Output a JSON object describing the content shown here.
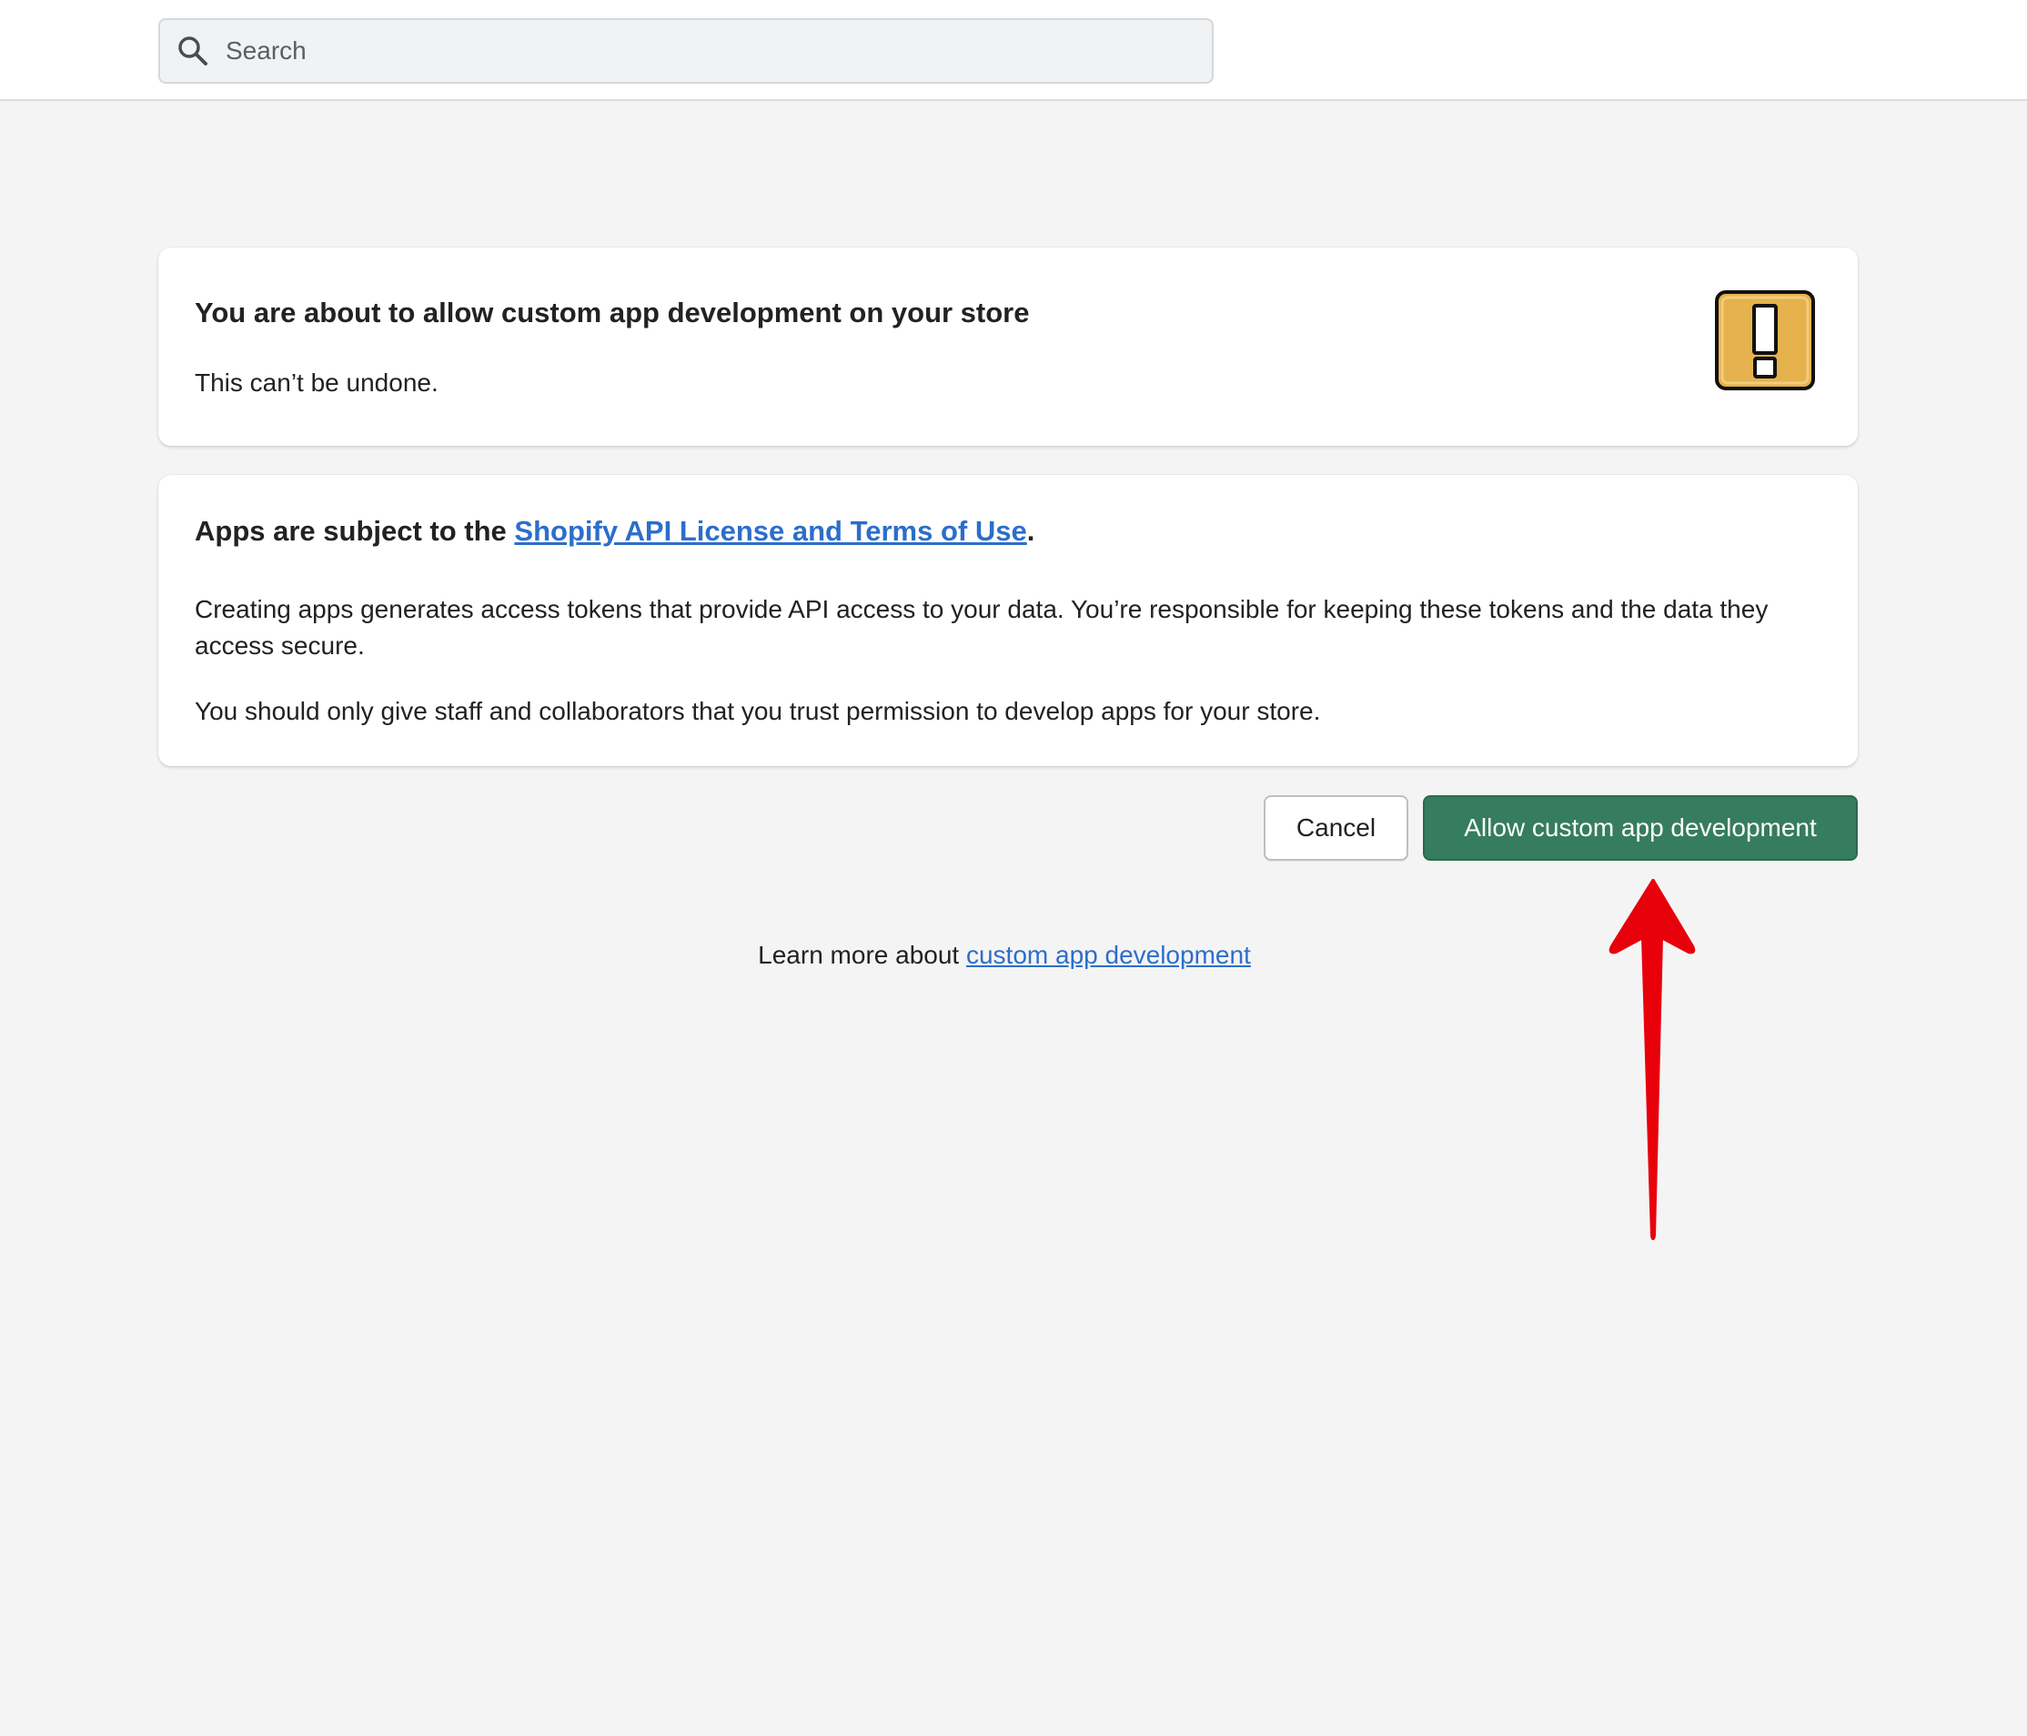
{
  "search": {
    "placeholder": "Search"
  },
  "warning_card": {
    "title": "You are about to allow custom app development on your store",
    "subtitle": "This can’t be undone.",
    "icon": "exclamation-warning-icon"
  },
  "terms_card": {
    "title_prefix": "Apps are subject to the ",
    "title_link": "Shopify API License and Terms of Use",
    "title_suffix": ".",
    "paragraph1": "Creating apps generates access tokens that provide API access to your data. You’re responsible for keeping these tokens and the data they access secure.",
    "paragraph2": "You should only give staff and collaborators that you trust permission to develop apps for your store."
  },
  "actions": {
    "cancel_label": "Cancel",
    "allow_label": "Allow custom app development"
  },
  "footer": {
    "learn_prefix": "Learn more about ",
    "learn_link": "custom app development"
  },
  "annotation": {
    "arrow_icon": "red-arrow-up-icon",
    "arrow_color": "#e8000b"
  },
  "colors": {
    "primary_button": "#367c5e",
    "link": "#2c6ecb",
    "background": "#f4f4f4"
  }
}
